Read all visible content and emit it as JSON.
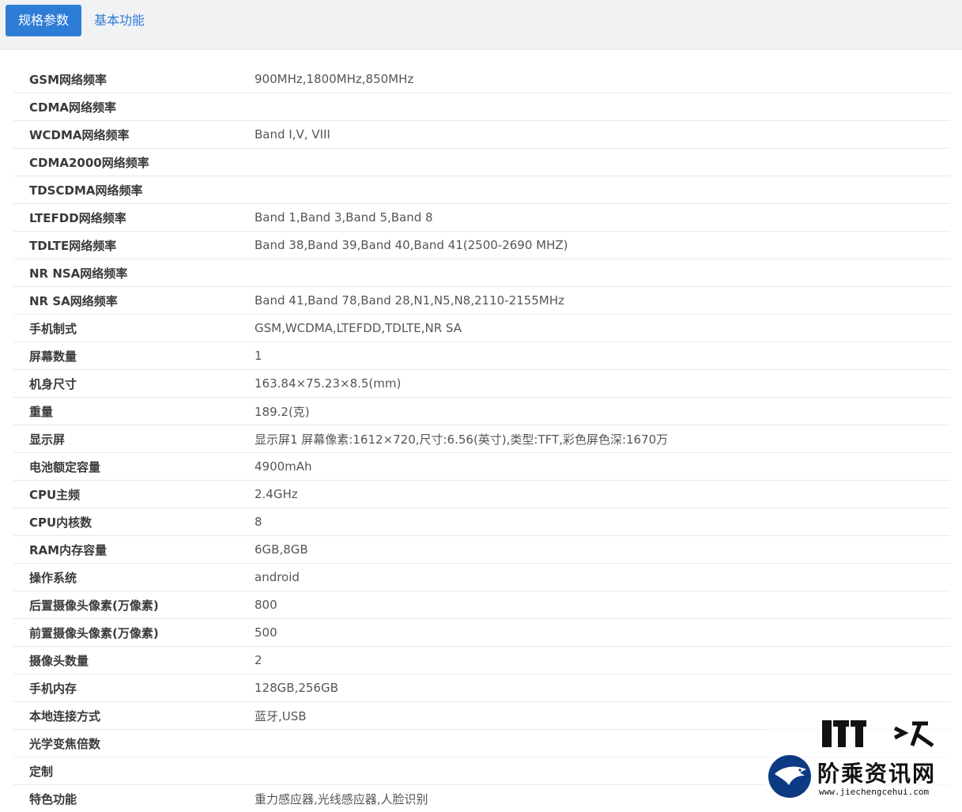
{
  "tabs": [
    {
      "label": "规格参数",
      "active": true
    },
    {
      "label": "基本功能",
      "active": false
    }
  ],
  "accent_color": "#2d7cd6",
  "specs": [
    {
      "label": "GSM网络频率",
      "value": "900MHz,1800MHz,850MHz"
    },
    {
      "label": "CDMA网络频率",
      "value": ""
    },
    {
      "label": "WCDMA网络频率",
      "value": "Band Ⅰ,V, VIII"
    },
    {
      "label": "CDMA2000网络频率",
      "value": ""
    },
    {
      "label": "TDSCDMA网络频率",
      "value": ""
    },
    {
      "label": "LTEFDD网络频率",
      "value": "Band 1,Band 3,Band 5,Band 8"
    },
    {
      "label": "TDLTE网络频率",
      "value": "Band 38,Band 39,Band 40,Band 41(2500-2690 MHZ)"
    },
    {
      "label": "NR NSA网络频率",
      "value": ""
    },
    {
      "label": "NR SA网络频率",
      "value": "Band 41,Band 78,Band 28,N1,N5,N8,2110-2155MHz"
    },
    {
      "label": "手机制式",
      "value": "GSM,WCDMA,LTEFDD,TDLTE,NR SA"
    },
    {
      "label": "屏幕数量",
      "value": "1"
    },
    {
      "label": "机身尺寸",
      "value": "163.84×75.23×8.5(mm)"
    },
    {
      "label": "重量",
      "value": "189.2(克)"
    },
    {
      "label": "显示屏",
      "value": "显示屏1 屏幕像素:1612×720,尺寸:6.56(英寸),类型:TFT,彩色屏色深:1670万"
    },
    {
      "label": "电池额定容量",
      "value": "4900mAh"
    },
    {
      "label": "CPU主频",
      "value": "2.4GHz"
    },
    {
      "label": "CPU内核数",
      "value": "8"
    },
    {
      "label": "RAM内存容量",
      "value": "6GB,8GB"
    },
    {
      "label": "操作系统",
      "value": "android"
    },
    {
      "label": "后置摄像头像素(万像素)",
      "value": "800"
    },
    {
      "label": "前置摄像头像素(万像素)",
      "value": "500"
    },
    {
      "label": "摄像头数量",
      "value": "2"
    },
    {
      "label": "手机内存",
      "value": "128GB,256GB"
    },
    {
      "label": "本地连接方式",
      "value": "蓝牙,USB"
    },
    {
      "label": "光学变焦倍数",
      "value": ""
    },
    {
      "label": "定制",
      "value": ""
    },
    {
      "label": "特色功能",
      "value": "重力感应器,光线感应器,人脸识别"
    }
  ],
  "watermark": {
    "title": "阶乘资讯网",
    "url": "www.jiechengcehui.com"
  }
}
